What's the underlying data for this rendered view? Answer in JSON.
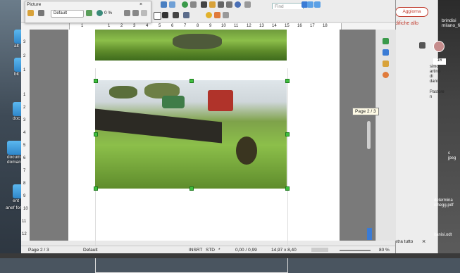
{
  "picture_toolbar": {
    "title": "Picture",
    "style_select": "Default",
    "zoom_percent": "0 %"
  },
  "toolbar": {
    "find_placeholder": "Find"
  },
  "ruler_numbers": [
    "1",
    "1",
    "2",
    "3",
    "4",
    "5",
    "6",
    "7",
    "8",
    "9",
    "10",
    "11",
    "12",
    "13",
    "14",
    "15",
    "16",
    "17",
    "18"
  ],
  "vruler_numbers": [
    "3",
    "2",
    "1",
    "1",
    "2",
    "3",
    "4",
    "5",
    "6",
    "7",
    "8",
    "9",
    "10",
    "11",
    "12"
  ],
  "page_indicator": "Page 2 / 3",
  "statusbar": {
    "page": "Page 2 / 3",
    "style": "Default",
    "insert_mode": "INSRT",
    "sel_mode": "STD",
    "asterisk": "*",
    "position": "0,00 / 0,99",
    "size": "14,97 x 8,40",
    "zoom": "80 %"
  },
  "desktop_icons": [
    {
      "label": "alt"
    },
    {
      "label": "bit"
    },
    {
      "label": "doc"
    },
    {
      "label": "docum"
    },
    {
      "label": "domand"
    },
    {
      "label": "ent"
    },
    {
      "label": "anef for"
    }
  ],
  "right_panel": {
    "button": "Aggiorna",
    "text1": "difiche allo",
    "files": [
      "brindisi",
      "milano_files"
    ],
    "notes": [
      "simo",
      "artino",
      "di",
      "dani",
      "Pastore",
      "n",
      "c",
      "jpeg",
      "determina",
      "ichegg.pdf",
      "itanisi.odt"
    ],
    "bottom_text": "stra tutto",
    "close": "×",
    "num_badge": "16"
  }
}
